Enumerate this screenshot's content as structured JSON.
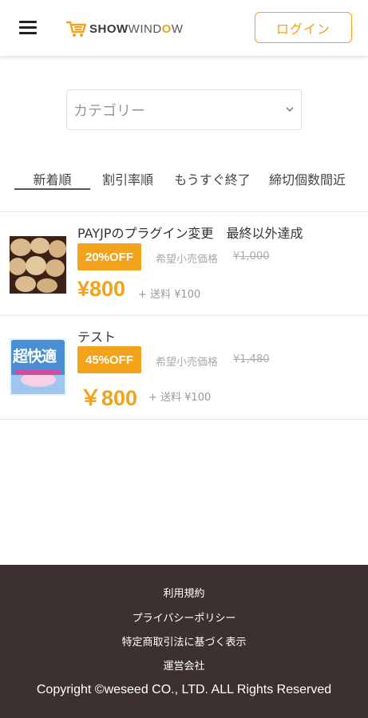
{
  "header": {
    "logo_bold": "SHOW",
    "logo_w": "WIND",
    "logo_o": "O",
    "logo_end": "W",
    "login_label": "ログイン"
  },
  "filter": {
    "category_placeholder": "カテゴリー"
  },
  "sort_tabs": [
    {
      "label": "新着順",
      "active": true
    },
    {
      "label": "割引率順",
      "active": false
    },
    {
      "label": "もうすぐ終了",
      "active": false
    },
    {
      "label": "締切個数間近",
      "active": false
    }
  ],
  "products": [
    {
      "title": "PAYJPのプラグイン変更　最終以外達成",
      "discount": "20%OFF",
      "list_price_label": "希望小売価格",
      "list_price": "¥1,000",
      "price": "¥800",
      "shipping": "+ 送料 ¥100",
      "image": "bread-rolls-thumbnail"
    },
    {
      "title": "テスト",
      "discount": "45%OFF",
      "list_price_label": "希望小売価格",
      "list_price": "¥1,480",
      "price": "￥800",
      "shipping": "+ 送料 ¥100",
      "image": "diaper-package-thumbnail",
      "package_text": "超快適"
    }
  ],
  "footer": {
    "links": [
      "利用規約",
      "プライバシーポリシー",
      "特定商取引法に基づく表示",
      "運営会社"
    ],
    "copyright": "Copyright ©weseed CO., LTD. ALL Rights Reserved"
  },
  "colors": {
    "accent": "#f2a21b",
    "footer_bg": "#3d3130"
  }
}
